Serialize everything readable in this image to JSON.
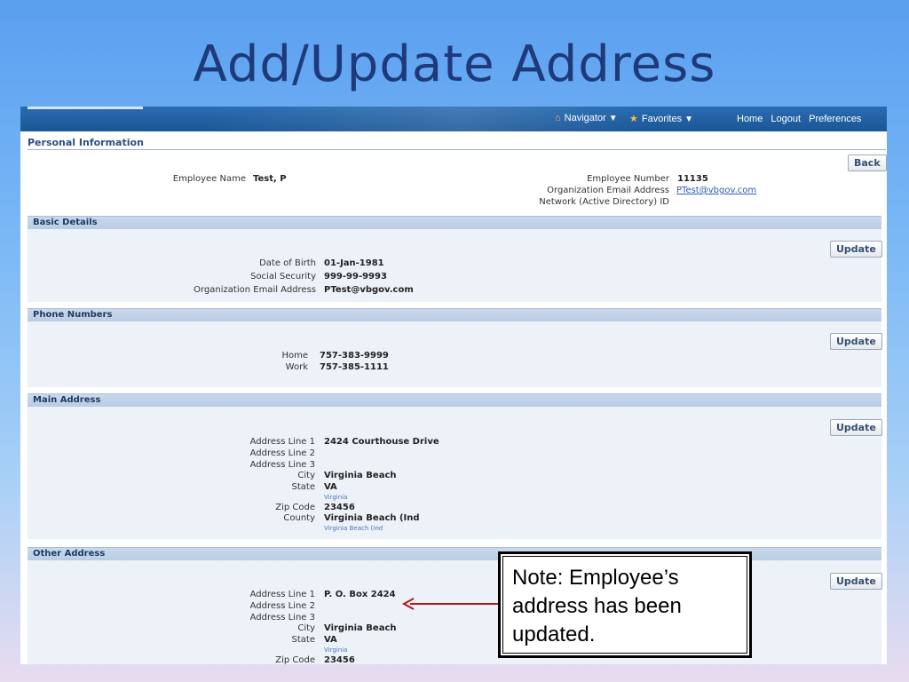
{
  "slide": {
    "title": "Add/Update Address"
  },
  "header": {
    "navigator": "Navigator",
    "favorites": "Favorites",
    "links": [
      "Home",
      "Logout",
      "Preferences"
    ]
  },
  "personal": {
    "title": "Personal Information",
    "back_label": "Back",
    "employee_name_label": "Employee Name",
    "employee_name": "Test, P",
    "employee_number_label": "Employee Number",
    "employee_number": "11135",
    "org_email_label": "Organization Email Address",
    "org_email": "PTest@vbgov.com",
    "network_id_label": "Network (Active Directory) ID"
  },
  "basic": {
    "title": "Basic Details",
    "update_label": "Update",
    "dob_label": "Date of Birth",
    "dob": "01-Jan-1981",
    "ssn_label": "Social Security",
    "ssn": "999-99-9993",
    "email_label": "Organization Email Address",
    "email": "PTest@vbgov.com"
  },
  "phone": {
    "title": "Phone Numbers",
    "update_label": "Update",
    "home_label": "Home",
    "home": "757-383-9999",
    "work_label": "Work",
    "work": "757-385-1111"
  },
  "main_address": {
    "title": "Main Address",
    "update_label": "Update",
    "line1_label": "Address Line 1",
    "line1": "2424 Courthouse Drive",
    "line2_label": "Address Line 2",
    "line3_label": "Address Line 3",
    "city_label": "City",
    "city": "Virginia Beach",
    "state_label": "State",
    "state": "VA",
    "state_sub": "Virginia",
    "zip_label": "Zip Code",
    "zip": "23456",
    "county_label": "County",
    "county": "Virginia Beach (Ind",
    "county_sub": "Virginia Beach (Ind"
  },
  "other_address": {
    "title": "Other Address",
    "update_label": "Update",
    "line1_label": "Address Line 1",
    "line1": "P. O. Box 2424",
    "line2_label": "Address Line 2",
    "line3_label": "Address Line 3",
    "city_label": "City",
    "city": "Virginia Beach",
    "state_label": "State",
    "state": "VA",
    "state_sub": "Virginia",
    "zip_label": "Zip Code",
    "zip": "23456"
  },
  "note": {
    "text": "Note: Employee’s address has been updated."
  },
  "colors": {
    "arrow": "#b01818",
    "title": "#1f3a7a",
    "banner": "#1b5796"
  }
}
